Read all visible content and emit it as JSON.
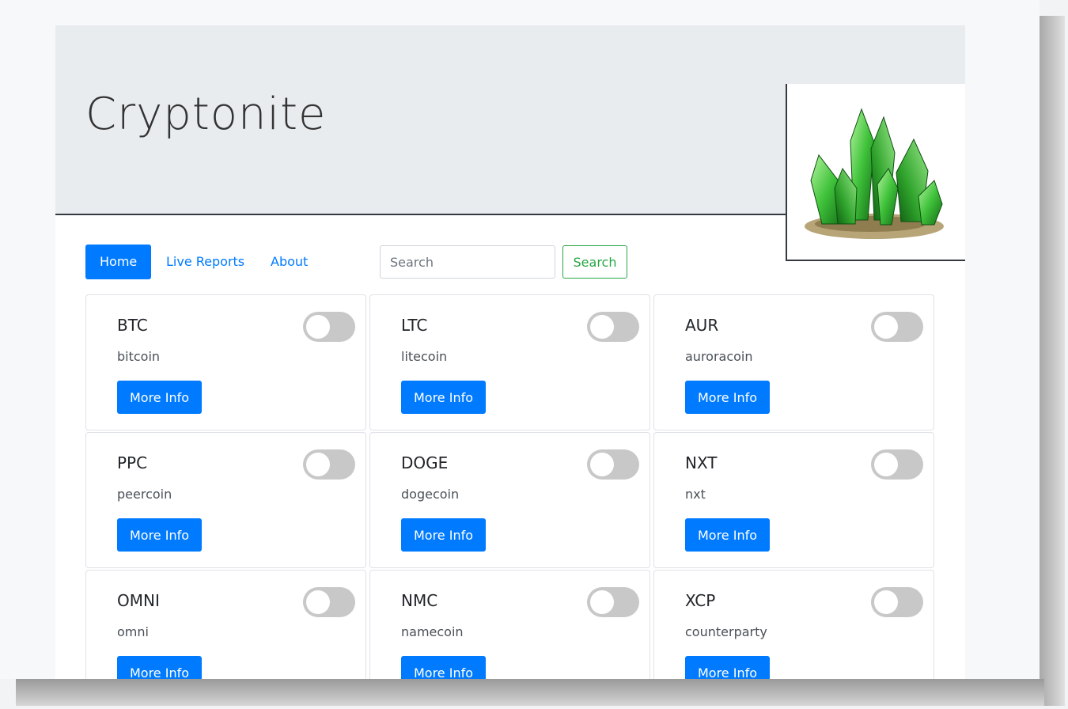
{
  "header": {
    "title": "Cryptonite"
  },
  "nav": {
    "items": [
      {
        "label": "Home",
        "active": true
      },
      {
        "label": "Live Reports",
        "active": false
      },
      {
        "label": "About",
        "active": false
      }
    ]
  },
  "search": {
    "placeholder": "Search",
    "button_label": "Search"
  },
  "coins": [
    {
      "symbol": "BTC",
      "name": "bitcoin",
      "button": "More Info",
      "toggled": false
    },
    {
      "symbol": "LTC",
      "name": "litecoin",
      "button": "More Info",
      "toggled": false
    },
    {
      "symbol": "AUR",
      "name": "auroracoin",
      "button": "More Info",
      "toggled": false
    },
    {
      "symbol": "PPC",
      "name": "peercoin",
      "button": "More Info",
      "toggled": false
    },
    {
      "symbol": "DOGE",
      "name": "dogecoin",
      "button": "More Info",
      "toggled": false
    },
    {
      "symbol": "NXT",
      "name": "nxt",
      "button": "More Info",
      "toggled": false
    },
    {
      "symbol": "OMNI",
      "name": "omni",
      "button": "More Info",
      "toggled": false
    },
    {
      "symbol": "NMC",
      "name": "namecoin",
      "button": "More Info",
      "toggled": false
    },
    {
      "symbol": "XCP",
      "name": "counterparty",
      "button": "More Info",
      "toggled": false
    }
  ],
  "colors": {
    "primary": "#007bff",
    "success": "#28a745",
    "jumbotron_bg": "#e9ecef",
    "toggle_off": "#c8c8c8"
  },
  "icons": {
    "logo": "green-crystal-icon"
  }
}
